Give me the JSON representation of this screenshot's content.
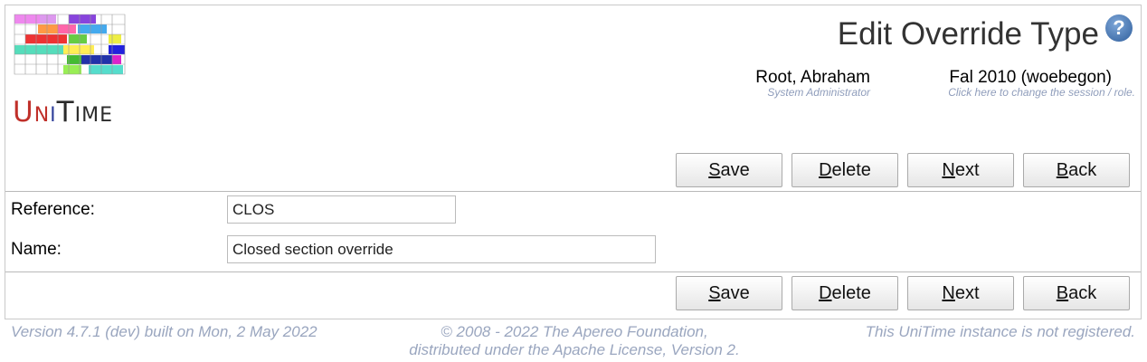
{
  "header": {
    "title": "Edit Override Type",
    "help_icon": "help-question-icon",
    "logo_text": "UniTime"
  },
  "user": {
    "name": "Root, Abraham",
    "role": "System Administrator"
  },
  "session": {
    "name": "Fal 2010 (woebegon)",
    "hint": "Click here to change the session / role."
  },
  "buttons": {
    "save": {
      "first": "S",
      "rest": "ave"
    },
    "delete": {
      "first": "D",
      "rest": "elete"
    },
    "next": {
      "first": "N",
      "rest": "ext"
    },
    "back": {
      "first": "B",
      "rest": "ack"
    }
  },
  "form": {
    "reference_label": "Reference:",
    "reference_value": "CLOS",
    "name_label": "Name:",
    "name_value": "Closed section override"
  },
  "footer": {
    "version": "Version 4.7.1 (dev) built on Mon, 2 May 2022",
    "copyright_line1": "© 2008 - 2022 The Apereo Foundation,",
    "copyright_line2": "distributed under the Apache License, Version 2.",
    "registration": "This UniTime instance is not registered."
  },
  "colors": {
    "accent": "#8f9dbb",
    "footer_text": "#9aa6bf"
  }
}
